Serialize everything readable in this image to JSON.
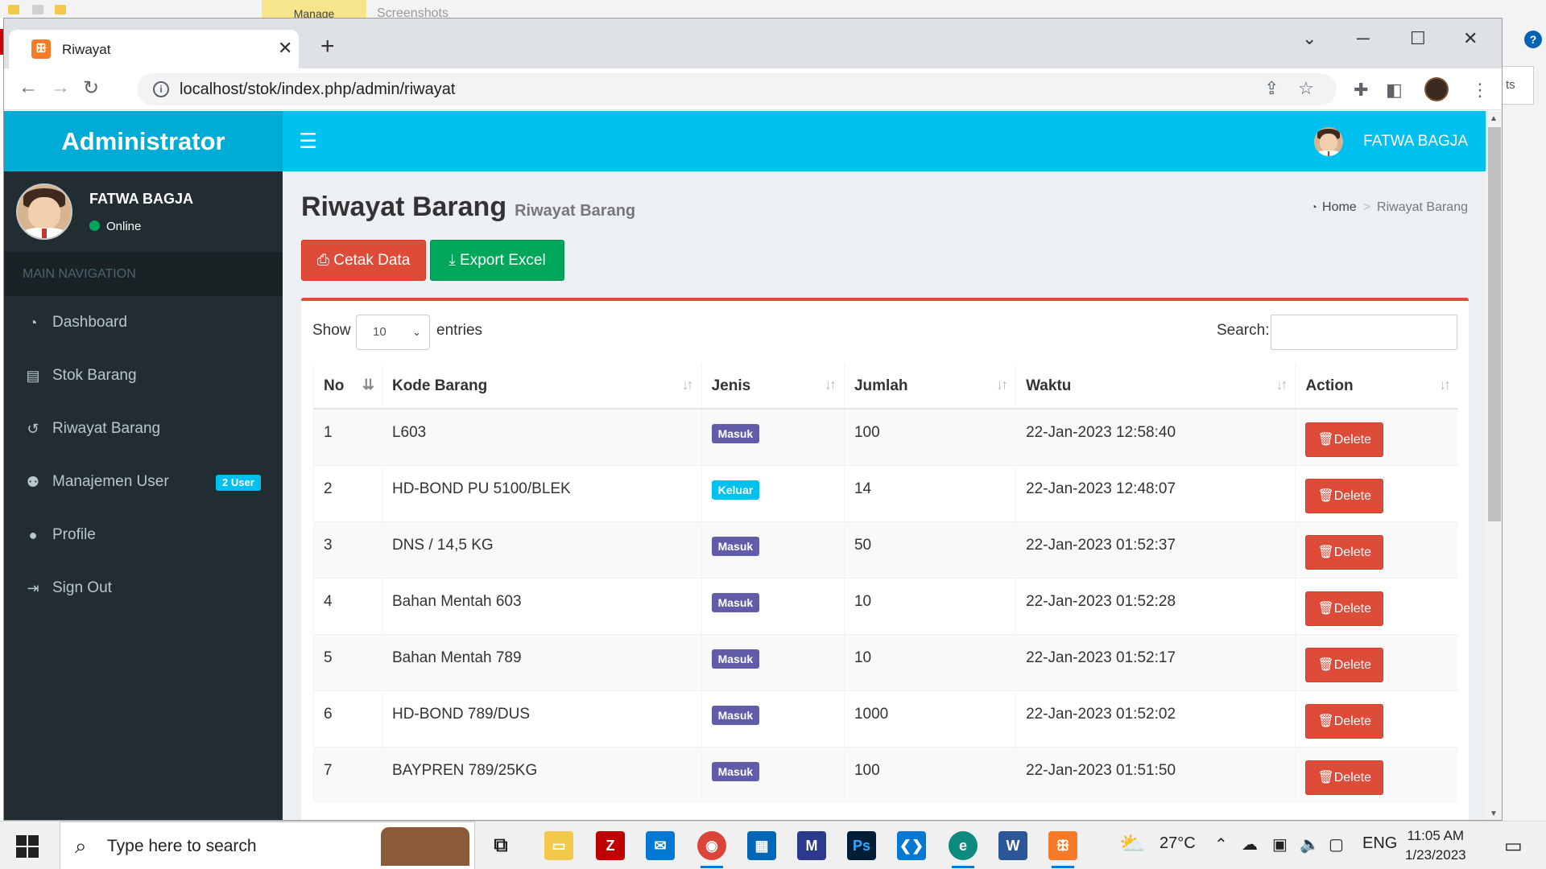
{
  "background": {
    "manage_tab": "Manage",
    "screenshots_tab": "Screenshots",
    "help": "?",
    "right_partial_text": "ts"
  },
  "browser": {
    "tab_title": "Riwayat",
    "url": "localhost/stok/index.php/admin/riwayat"
  },
  "app": {
    "logo": "Administrator",
    "header_user": "FATWA BAGJA"
  },
  "sidebar": {
    "user_name": "FATWA BAGJA",
    "user_status": "Online",
    "section_header": "MAIN NAVIGATION",
    "items": [
      {
        "label": "Dashboard",
        "icon": "dashboard-icon"
      },
      {
        "label": "Stok Barang",
        "icon": "book-icon"
      },
      {
        "label": "Riwayat Barang",
        "icon": "history-icon"
      },
      {
        "label": "Manajemen User",
        "icon": "users-icon",
        "badge": "2 User"
      },
      {
        "label": "Profile",
        "icon": "user-icon"
      },
      {
        "label": "Sign Out",
        "icon": "sign-out-icon"
      }
    ]
  },
  "content": {
    "title": "Riwayat Barang",
    "subtitle": "Riwayat Barang",
    "breadcrumb": {
      "home": "Home",
      "current": "Riwayat Barang"
    },
    "buttons": {
      "print": "Cetak Data",
      "export": "Export Excel"
    }
  },
  "datatable": {
    "show_label": "Show",
    "page_length": "10",
    "entries_label": "entries",
    "search_label": "Search:",
    "search_value": "",
    "columns": [
      "No",
      "Kode Barang",
      "Jenis",
      "Jumlah",
      "Waktu",
      "Action"
    ],
    "rows": [
      {
        "no": "1",
        "kode": "L603",
        "jenis": "Masuk",
        "jumlah": "100",
        "waktu": "22-Jan-2023 12:58:40",
        "action": "Delete"
      },
      {
        "no": "2",
        "kode": "HD-BOND PU 5100/BLEK",
        "jenis": "Keluar",
        "jumlah": "14",
        "waktu": "22-Jan-2023 12:48:07",
        "action": "Delete"
      },
      {
        "no": "3",
        "kode": "DNS / 14,5 KG",
        "jenis": "Masuk",
        "jumlah": "50",
        "waktu": "22-Jan-2023 01:52:37",
        "action": "Delete"
      },
      {
        "no": "4",
        "kode": "Bahan Mentah 603",
        "jenis": "Masuk",
        "jumlah": "10",
        "waktu": "22-Jan-2023 01:52:28",
        "action": "Delete"
      },
      {
        "no": "5",
        "kode": "Bahan Mentah 789",
        "jenis": "Masuk",
        "jumlah": "10",
        "waktu": "22-Jan-2023 01:52:17",
        "action": "Delete"
      },
      {
        "no": "6",
        "kode": "HD-BOND 789/DUS",
        "jenis": "Masuk",
        "jumlah": "1000",
        "waktu": "22-Jan-2023 01:52:02",
        "action": "Delete"
      },
      {
        "no": "7",
        "kode": "BAYPREN 789/25KG",
        "jenis": "Masuk",
        "jumlah": "100",
        "waktu": "22-Jan-2023 01:51:50",
        "action": "Delete"
      }
    ]
  },
  "taskbar": {
    "search_placeholder": "Type here to search",
    "temperature": "27°C",
    "language": "ENG",
    "time": "11:05 AM",
    "date": "1/23/2023",
    "apps": [
      "task-view",
      "file-explorer",
      "filezilla",
      "mail",
      "chrome",
      "microsoft-store",
      "app-m",
      "photoshop",
      "vscode",
      "edge",
      "word",
      "xampp"
    ]
  },
  "colors": {
    "header": "#00c0ef",
    "logo_bg": "#00acd6",
    "sidebar": "#222d32",
    "danger": "#dd4b39",
    "success": "#00a65a",
    "masuk": "#605ca8",
    "keluar": "#00c0ef"
  }
}
